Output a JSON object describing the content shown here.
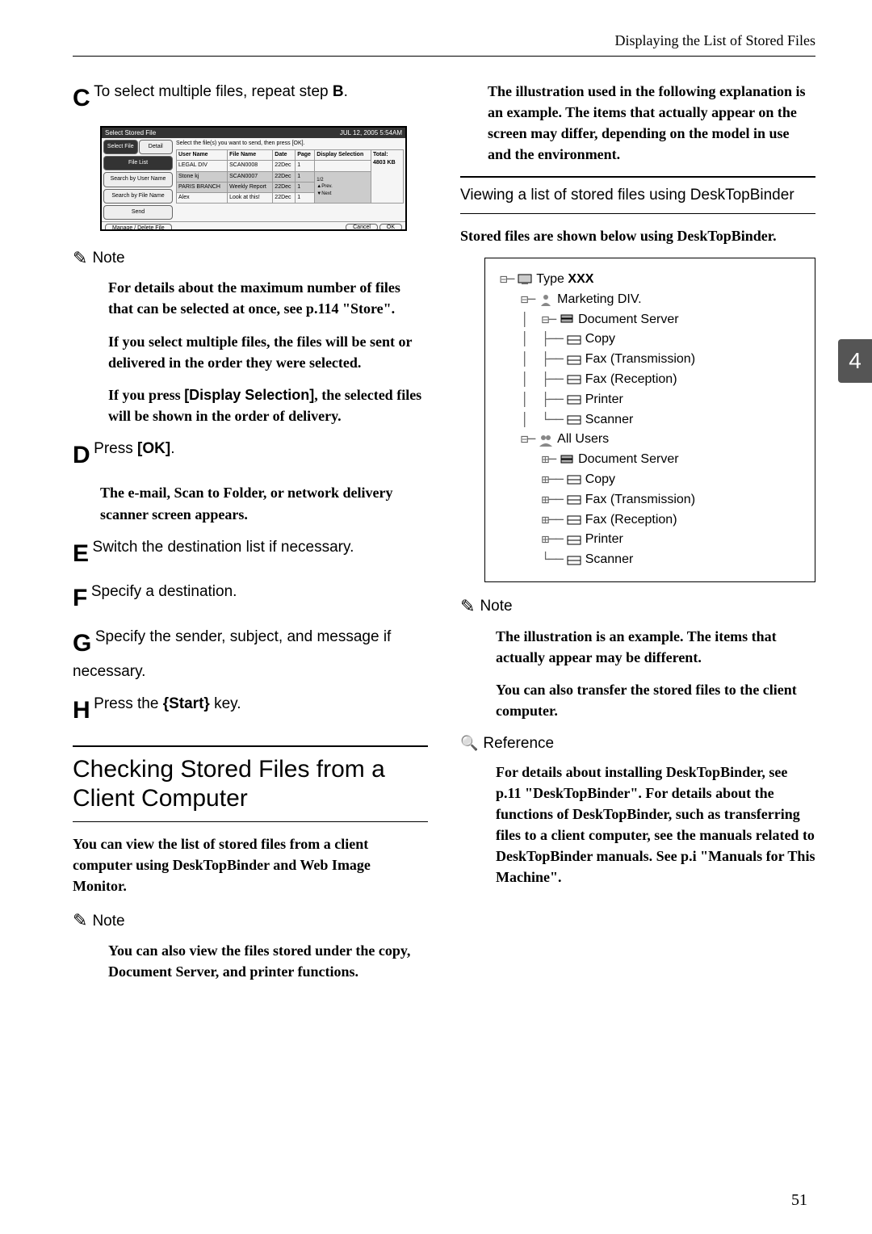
{
  "header": {
    "title": "Displaying the List of Stored Files"
  },
  "page_tab": "4",
  "page_number": "51",
  "left": {
    "stepC": {
      "letter": "C",
      "text1": "To select multiple files, repeat step ",
      "key": "B",
      "text2": "."
    },
    "screenshot": {
      "titlebar_left": "Select Stored File",
      "titlebar_right": "JUL   12, 2005   5:54AM",
      "hint": "Select the file(s) you want to send, then press [OK].",
      "tabs": {
        "sel": "Select File",
        "detail": "Detail"
      },
      "left_buttons": [
        "File List",
        "Search by User Name",
        "Search by File Name",
        "Send"
      ],
      "footer_btn": "Manage / Delete File",
      "cols": [
        "User Name",
        "File Name",
        "Date",
        "Page"
      ],
      "sort_btn": "Display Selection",
      "rows": [
        [
          "LEGAL DIV",
          "SCAN0008",
          "22Dec",
          "1"
        ],
        [
          "Stone kj",
          "SCAN0007",
          "22Dec",
          "1"
        ],
        [
          "PARIS BRANCH",
          "Weekly Report",
          "22Dec",
          "1"
        ],
        [
          "Alex",
          "Look at this!",
          "22Dec",
          "1"
        ]
      ],
      "nav": {
        "up": "▲Prev.",
        "down": "▼Next",
        "pos": "1/2",
        "n1": "1",
        "n2": "2"
      },
      "total": "Total:",
      "total_val": "4803 KB",
      "cancel": "Cancel",
      "ok": "OK"
    },
    "note1_head": "Note",
    "note1_p1a": "For details about the maximum number of files that can be selected at once, see p.114 ",
    "note1_p1b": "\"Store\"",
    "note1_p1c": ".",
    "note1_p2": "If you select multiple files, the files will be sent or delivered in the order they were selected.",
    "note1_p3a": "If you press ",
    "note1_p3b": "[Display Selection]",
    "note1_p3c": ", the selected files will be shown in the order of delivery.",
    "stepD": {
      "letter": "D",
      "text1": "Press ",
      "key": "[OK]",
      "text2": "."
    },
    "stepD_body": "The e-mail, Scan to Folder, or network delivery scanner screen appears.",
    "stepE": {
      "letter": "E",
      "text": "Switch the destination list if necessary."
    },
    "stepF": {
      "letter": "F",
      "text": "Specify a destination."
    },
    "stepG": {
      "letter": "G",
      "text": "Specify the sender, subject, and message if necessary."
    },
    "stepH": {
      "letter": "H",
      "text1": "Press the ",
      "key": "{Start}",
      "text2": " key."
    },
    "h2": "Checking Stored Files from a Client Computer",
    "h2_body": "You can view the list of stored files from a client computer using DeskTopBinder and Web Image Monitor.",
    "note2_head": "Note",
    "note2_body": "You can also view the files stored under the copy, Document Server, and printer functions."
  },
  "right": {
    "intro": "The illustration used in the following explanation is an example. The items that actually appear on the screen may differ, depending on the model in use and the environment.",
    "sub": "Viewing a list of stored files using DeskTopBinder",
    "sub_body": "Stored files are shown below using DeskTopBinder.",
    "tree": {
      "type": "Type ",
      "xxx": "XXX",
      "mkt": "Marketing DIV.",
      "ds": "Document Server",
      "copy": "Copy",
      "fax_t": "Fax (Transmission)",
      "fax_r": "Fax (Reception)",
      "printer": "Printer",
      "scanner": "Scanner",
      "all": "All Users"
    },
    "note3_head": "Note",
    "note3_p1": "The illustration is an example. The items that actually appear may be different.",
    "note3_p2": "You can also transfer the stored files to the client computer.",
    "ref_head": "Reference",
    "ref_body_a": "For details about installing DeskTopBinder, see p.11 ",
    "ref_body_b": "\"DeskTopBinder\"",
    "ref_body_c": ". For details about the functions of DeskTopBinder, such as transferring files to a client computer, see the manuals related to DeskTopBinder manuals. See p.i ",
    "ref_body_d": "\"Manuals for This Machine\"",
    "ref_body_e": "."
  }
}
